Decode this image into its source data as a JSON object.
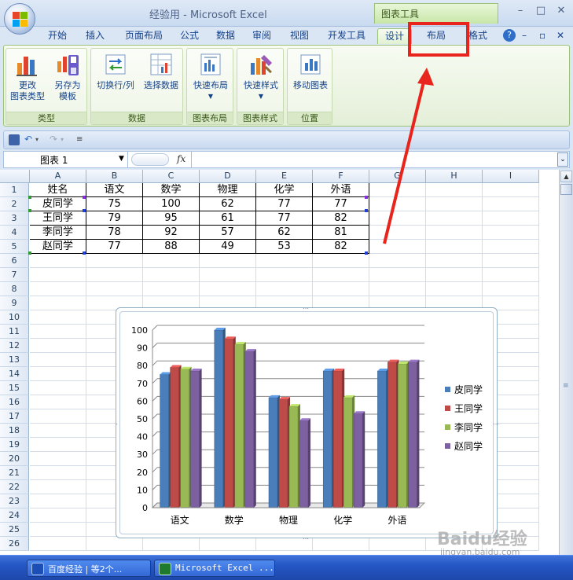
{
  "window": {
    "title": "经验用 - Microsoft Excel",
    "chart_tools_label": "图表工具",
    "minimize": "–",
    "restore": "□",
    "close": "✕"
  },
  "ribbon": {
    "tabs": [
      {
        "label": "开始"
      },
      {
        "label": "插入"
      },
      {
        "label": "页面布局"
      },
      {
        "label": "公式"
      },
      {
        "label": "数据"
      },
      {
        "label": "审阅"
      },
      {
        "label": "视图"
      },
      {
        "label": "开发工具"
      },
      {
        "label": "设计"
      },
      {
        "label": "布局"
      },
      {
        "label": "格式"
      }
    ],
    "active_tab": "设计",
    "highlighted_tab": "布局",
    "groups": [
      {
        "label": "类型",
        "buttons": [
          "更改\n图表类型",
          "另存为\n模板"
        ]
      },
      {
        "label": "数据",
        "buttons": [
          "切换行/列",
          "选择数据"
        ]
      },
      {
        "label": "图表布局",
        "buttons": [
          "快速布局"
        ]
      },
      {
        "label": "图表样式",
        "buttons": [
          "快速样式"
        ]
      },
      {
        "label": "位置",
        "buttons": [
          "移动图表"
        ]
      }
    ],
    "accent_color": "#9cc27a"
  },
  "formula_bar": {
    "name_box": "图表 1",
    "fx": "fx",
    "value": ""
  },
  "sheet": {
    "columns": [
      "A",
      "B",
      "C",
      "D",
      "E",
      "F",
      "G",
      "H",
      "I"
    ],
    "rows": [
      "1",
      "2",
      "3",
      "4",
      "5",
      "6",
      "7",
      "8",
      "9",
      "10",
      "11",
      "12",
      "13",
      "14",
      "15",
      "16",
      "17",
      "18",
      "19",
      "20",
      "21",
      "22",
      "23",
      "24",
      "25",
      "26"
    ],
    "table": [
      [
        "姓名",
        "语文",
        "数学",
        "物理",
        "化学",
        "外语"
      ],
      [
        "皮同学",
        "75",
        "100",
        "62",
        "77",
        "77"
      ],
      [
        "王同学",
        "79",
        "95",
        "61",
        "77",
        "82"
      ],
      [
        "李同学",
        "78",
        "92",
        "57",
        "62",
        "81"
      ],
      [
        "赵同学",
        "77",
        "88",
        "49",
        "53",
        "82"
      ]
    ]
  },
  "chart_data": {
    "type": "bar",
    "categories": [
      "语文",
      "数学",
      "物理",
      "化学",
      "外语"
    ],
    "series": [
      {
        "name": "皮同学",
        "values": [
          75,
          100,
          62,
          77,
          77
        ],
        "color": "#4a7ebb"
      },
      {
        "name": "王同学",
        "values": [
          79,
          95,
          61,
          77,
          82
        ],
        "color": "#be4b48"
      },
      {
        "name": "李同学",
        "values": [
          78,
          92,
          57,
          62,
          81
        ],
        "color": "#98b954"
      },
      {
        "name": "赵同学",
        "values": [
          77,
          88,
          49,
          53,
          82
        ],
        "color": "#7d60a0"
      }
    ],
    "yticks": [
      0,
      10,
      20,
      30,
      40,
      50,
      60,
      70,
      80,
      90,
      100
    ],
    "ylim": [
      0,
      100
    ],
    "grid": true,
    "legend": "right",
    "style": "3d-clustered-column"
  },
  "taskbar": {
    "items": [
      {
        "label": "百度经验 | 等2个..."
      },
      {
        "label": "Microsoft Excel ..."
      }
    ]
  },
  "watermark": {
    "text": "Baidu经验",
    "url": "jingyan.baidu.com"
  },
  "annotation": {
    "color": "#e8241c"
  }
}
